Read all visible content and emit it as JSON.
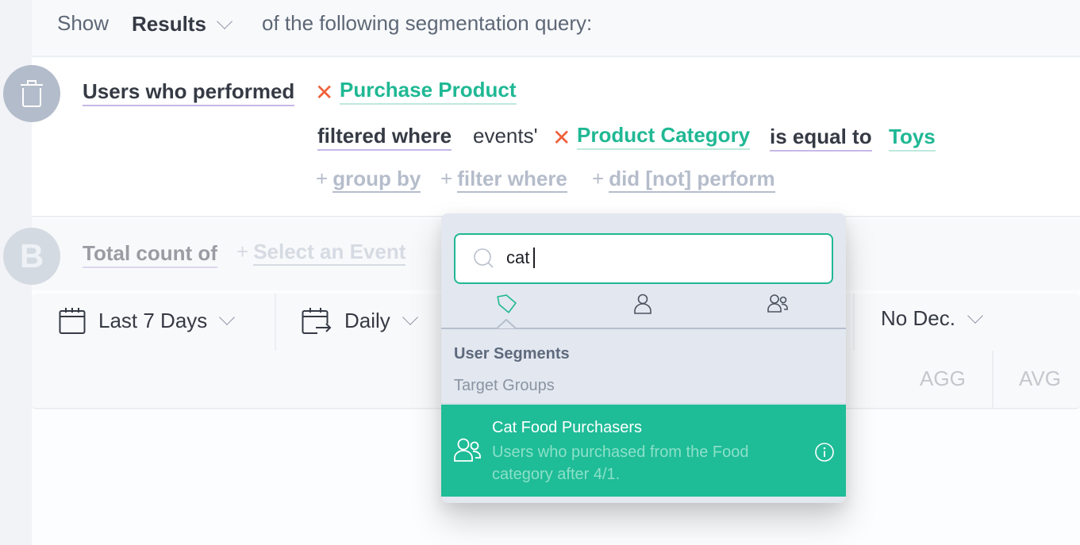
{
  "header": {
    "show_label": "Show",
    "mode_selected": "Results",
    "rest_label": "of the following segmentation query:"
  },
  "query_a": {
    "delete_icon": "trash-icon",
    "performed_label": "Users who performed",
    "event_name": "Purchase Product",
    "remove_icon": "x-icon",
    "filtered_label": "filtered where",
    "events_possessive": "events'",
    "property_name": "Product Category",
    "operator_label": "is equal to",
    "property_value": "Toys",
    "add_actions": [
      {
        "plus": "+",
        "label": "group by"
      },
      {
        "plus": "+",
        "label": "filter where"
      },
      {
        "plus": "+",
        "label": "did [not] perform"
      }
    ]
  },
  "query_b": {
    "badge_letter": "B",
    "total_label": "Total count of",
    "select_plus": "+",
    "select_label": "Select an Event"
  },
  "controls": {
    "date_range": "Last 7 Days",
    "interval": "Daily",
    "decimals": "No Dec.",
    "columns": [
      "AGG",
      "AVG"
    ]
  },
  "popup": {
    "search_value": "cat",
    "tabs": [
      {
        "icon": "tag-icon",
        "active": true
      },
      {
        "icon": "user-icon",
        "active": false
      },
      {
        "icon": "users-icon",
        "active": false
      }
    ],
    "section_title": "User Segments",
    "section_subtitle": "Target Groups",
    "results": [
      {
        "icon": "users-icon",
        "title": "Cat Food Purchasers",
        "description": "Users who purchased from the Food category after 4/1.",
        "highlighted": true
      }
    ]
  },
  "colors": {
    "accent_green": "#1fb894",
    "highlight_green": "#1ebc97",
    "remove_red": "#f0613a",
    "keyword_underline": "#c6b8e6"
  }
}
